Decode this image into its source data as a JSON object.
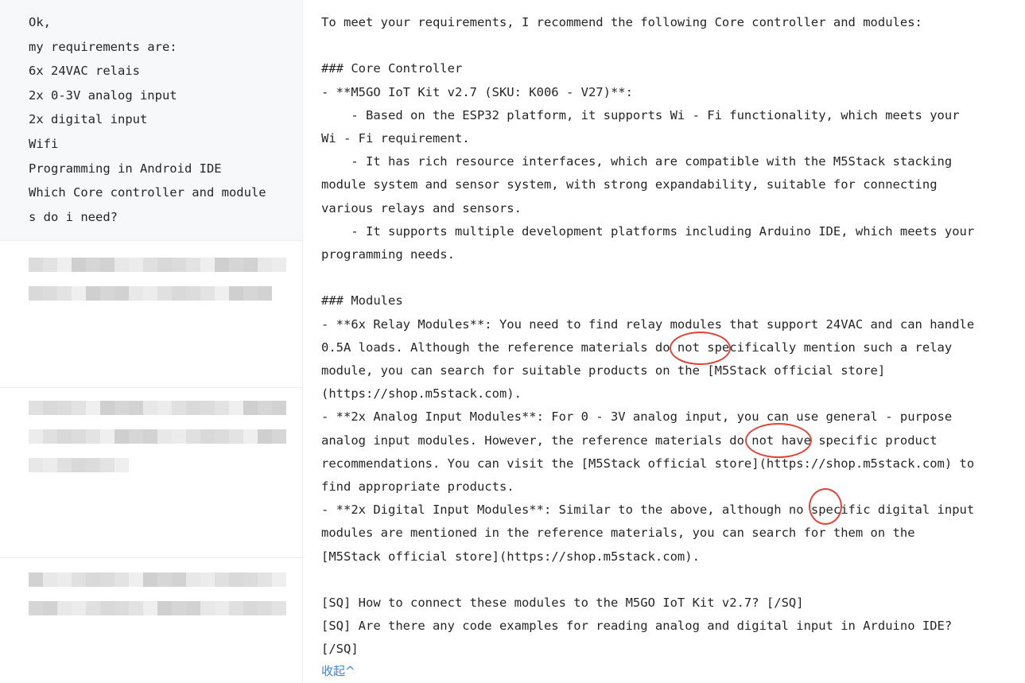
{
  "user_message": {
    "lines": [
      "Ok,",
      "my requirements are:",
      "6x 24VAC relais",
      "2x 0-3V analog input",
      "2x digital input",
      "Wifi",
      "Programming in Android IDE",
      "Which Core controller and module",
      "s do i need?"
    ]
  },
  "answer": {
    "lines": [
      "To meet your requirements, I recommend the following Core controller and modules:",
      "",
      "### Core Controller",
      "- **M5GO IoT Kit v2.7 (SKU: K006 - V27)**:",
      "    - Based on the ESP32 platform, it supports Wi - Fi functionality, which meets your",
      "Wi - Fi requirement.",
      "    - It has rich resource interfaces, which are compatible with the M5Stack stacking",
      "module system and sensor system, with strong expandability, suitable for connecting",
      "various relays and sensors.",
      "    - It supports multiple development platforms including Arduino IDE, which meets your",
      "programming needs.",
      "",
      "### Modules",
      "- **6x Relay Modules**: You need to find relay modules that support 24VAC and can handle",
      "0.5A loads. Although the reference materials do not specifically mention such a relay",
      "module, you can search for suitable products on the [M5Stack official store]",
      "(https://shop.m5stack.com).",
      "- **2x Analog Input Modules**: For 0 - 3V analog input, you can use general - purpose",
      "analog input modules. However, the reference materials do not have specific product",
      "recommendations. You can visit the [M5Stack official store](https://shop.m5stack.com) to",
      "find appropriate products.",
      "- **2x Digital Input Modules**: Similar to the above, although no specific digital input",
      "modules are mentioned in the reference materials, you can search for them on the",
      "[M5Stack official store](https://shop.m5stack.com).",
      "",
      "[SQ] How to connect these modules to the M5GO IoT Kit v2.7? [/SQ]",
      "[SQ] Are there any code examples for reading analog and digital input in Arduino IDE?",
      "[/SQ]"
    ],
    "collapse_label": "收起^"
  },
  "colors": {
    "annotation_circle": "#e0453a",
    "link": "#3b82f6",
    "user_bg": "#f7f8fa"
  }
}
